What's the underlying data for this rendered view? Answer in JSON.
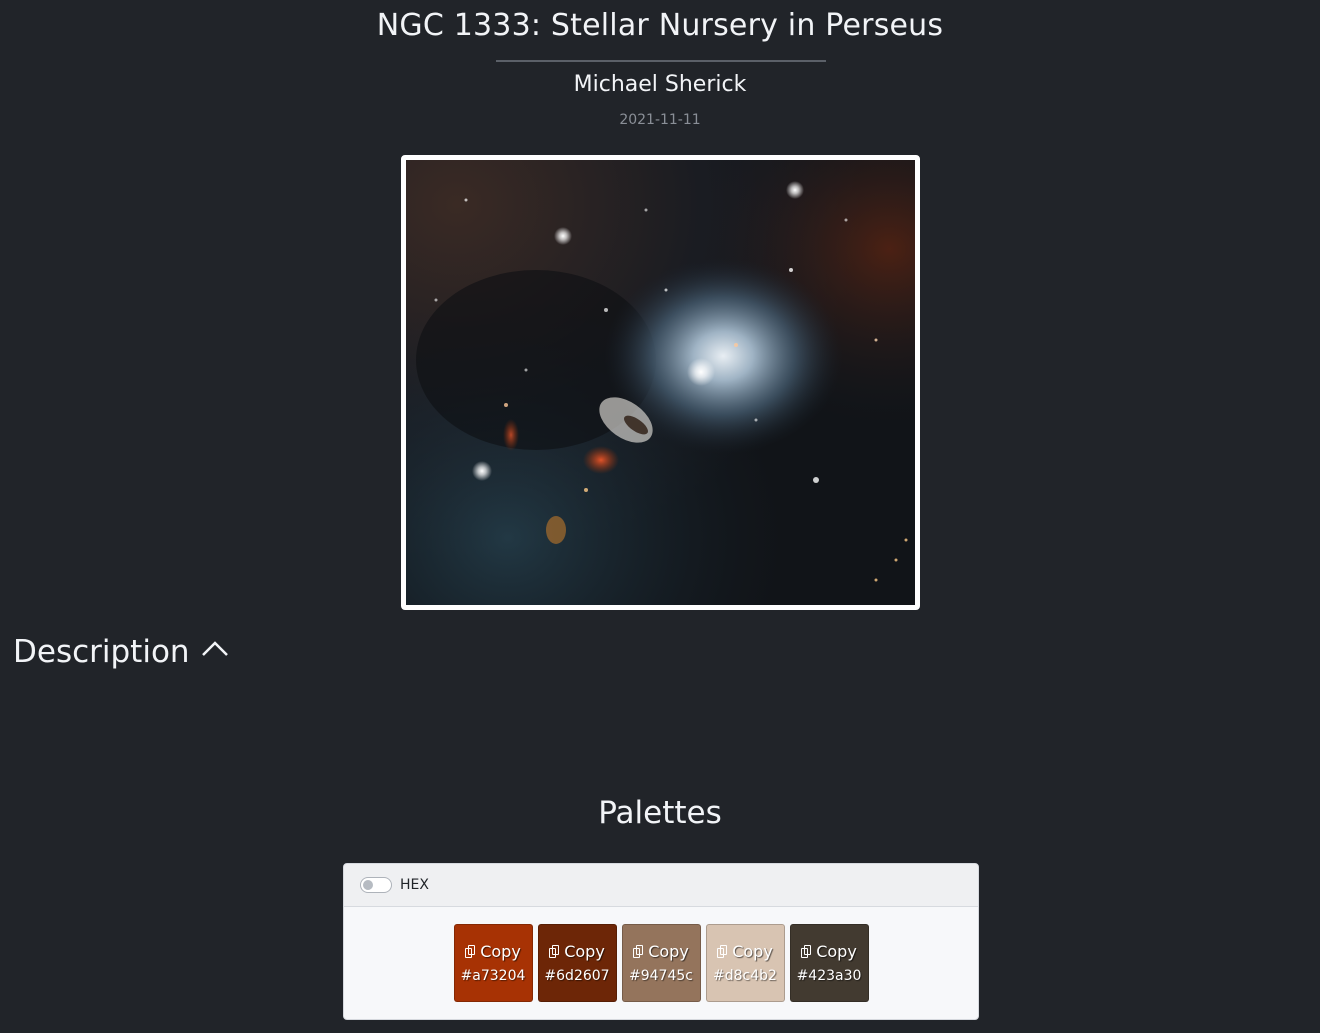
{
  "header": {
    "title": "NGC 1333: Stellar Nursery in Perseus",
    "author": "Michael Sherick",
    "date": "2021-11-11"
  },
  "image": {
    "alt": "NGC 1333 nebula photograph",
    "icon": "nebula-image"
  },
  "description": {
    "heading": "Description",
    "toggle_icon": "chevron-up-icon"
  },
  "palettes": {
    "heading": "Palettes",
    "hex_toggle_label": "HEX",
    "copy_label": "Copy",
    "swatches": [
      {
        "color": "#a73204",
        "label": "#a73204"
      },
      {
        "color": "#6d2607",
        "label": "#6d2607"
      },
      {
        "color": "#94745c",
        "label": "#94745c"
      },
      {
        "color": "#d8c4b2",
        "label": "#d8c4b2"
      },
      {
        "color": "#423a30",
        "label": "#423a30"
      }
    ]
  }
}
